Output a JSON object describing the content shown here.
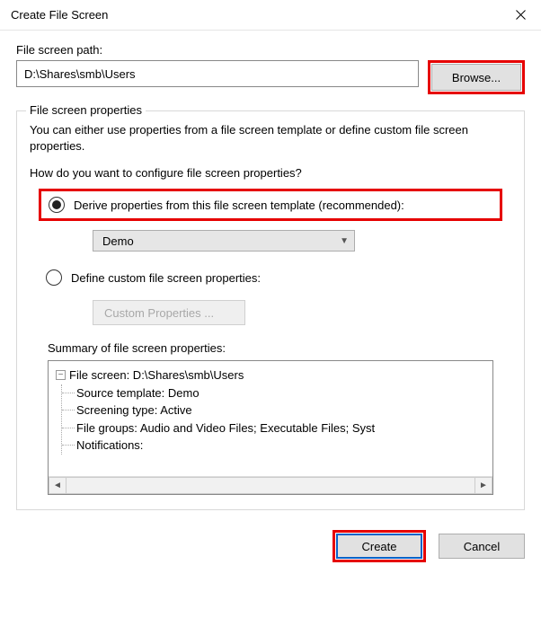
{
  "window": {
    "title": "Create File Screen"
  },
  "path": {
    "label": "File screen path:",
    "value": "D:\\Shares\\smb\\Users",
    "browse": "Browse..."
  },
  "properties": {
    "legend": "File screen properties",
    "desc": "You can either use properties from a file screen template or define custom file screen properties.",
    "question": "How do you want to configure file screen properties?",
    "radio_derive": "Derive properties from this file screen template (recommended):",
    "template_selected": "Demo",
    "radio_custom": "Define custom file screen properties:",
    "custom_button": "Custom Properties ...",
    "summary_label": "Summary of file screen properties:",
    "tree": {
      "root": "File screen: D:\\Shares\\smb\\Users",
      "items": [
        "Source template: Demo",
        "Screening type: Active",
        "File groups: Audio and Video Files; Executable Files; Syst",
        "Notifications:"
      ]
    }
  },
  "buttons": {
    "create": "Create",
    "cancel": "Cancel"
  }
}
